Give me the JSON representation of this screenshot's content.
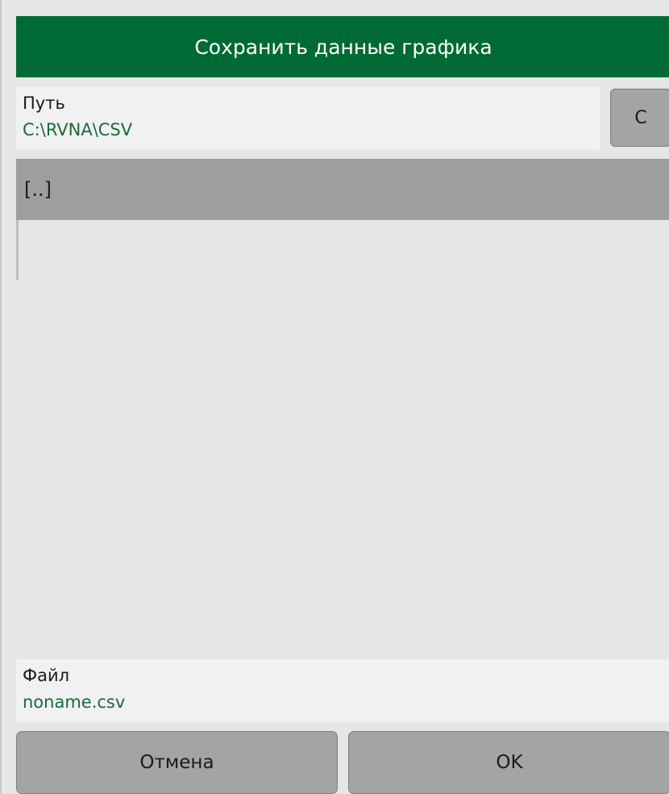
{
  "dialog": {
    "title": "Сохранить данные графика"
  },
  "path": {
    "label": "Путь",
    "value": "C:\\RVNA\\CSV",
    "drive_button_label": "C"
  },
  "file_list": {
    "items": [
      {
        "label": "[..]"
      }
    ]
  },
  "file": {
    "label": "Файл",
    "value": "noname.csv"
  },
  "buttons": {
    "cancel_label": "Отмена",
    "ok_label": "OK"
  },
  "colors": {
    "title_bar": "#006a36",
    "value_text": "#1a6a3a",
    "button_bg": "#a4a4a4",
    "selected_row": "#9e9e9e",
    "dialog_bg": "#e6e6e6"
  }
}
